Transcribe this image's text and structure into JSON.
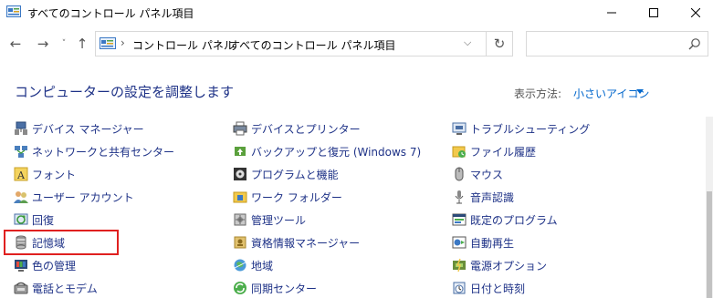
{
  "window": {
    "title": "すべてのコントロール パネル項目",
    "min_icon": "minimize-icon",
    "max_icon": "maximize-icon",
    "close_icon": "close-icon"
  },
  "nav": {
    "back": "←",
    "forward": "→",
    "recent": "˅",
    "up": "↑",
    "breadcrumb": [
      "コントロール パネル",
      "すべてのコントロール パネル項目"
    ],
    "separator": "›",
    "dropdown": "⌵",
    "refresh": "↻",
    "search_placeholder": ""
  },
  "heading": "コンピューターの設定を調整します",
  "view_by": {
    "label": "表示方法:",
    "value": "小さいアイコン"
  },
  "items": [
    {
      "label": "デバイス マネージャー",
      "icon": "device-manager-icon",
      "col": 0,
      "row": 0
    },
    {
      "label": "ネットワークと共有センター",
      "icon": "network-icon",
      "col": 0,
      "row": 1
    },
    {
      "label": "フォント",
      "icon": "fonts-icon",
      "col": 0,
      "row": 2
    },
    {
      "label": "ユーザー アカウント",
      "icon": "user-accounts-icon",
      "col": 0,
      "row": 3
    },
    {
      "label": "回復",
      "icon": "recovery-icon",
      "col": 0,
      "row": 4
    },
    {
      "label": "記憶域",
      "icon": "storage-icon",
      "col": 0,
      "row": 5
    },
    {
      "label": "色の管理",
      "icon": "color-management-icon",
      "col": 0,
      "row": 6
    },
    {
      "label": "電話とモデム",
      "icon": "phone-modem-icon",
      "col": 0,
      "row": 7
    },
    {
      "label": "デバイスとプリンター",
      "icon": "printer-icon",
      "col": 1,
      "row": 0
    },
    {
      "label": "バックアップと復元 (Windows 7)",
      "icon": "backup-icon",
      "col": 1,
      "row": 1
    },
    {
      "label": "プログラムと機能",
      "icon": "programs-icon",
      "col": 1,
      "row": 2
    },
    {
      "label": "ワーク フォルダー",
      "icon": "work-folders-icon",
      "col": 1,
      "row": 3
    },
    {
      "label": "管理ツール",
      "icon": "admin-tools-icon",
      "col": 1,
      "row": 4
    },
    {
      "label": "資格情報マネージャー",
      "icon": "credential-icon",
      "col": 1,
      "row": 5
    },
    {
      "label": "地域",
      "icon": "region-icon",
      "col": 1,
      "row": 6
    },
    {
      "label": "同期センター",
      "icon": "sync-icon",
      "col": 1,
      "row": 7
    },
    {
      "label": "トラブルシューティング",
      "icon": "troubleshoot-icon",
      "col": 2,
      "row": 0
    },
    {
      "label": "ファイル履歴",
      "icon": "file-history-icon",
      "col": 2,
      "row": 1
    },
    {
      "label": "マウス",
      "icon": "mouse-icon",
      "col": 2,
      "row": 2
    },
    {
      "label": "音声認識",
      "icon": "microphone-icon",
      "col": 2,
      "row": 3
    },
    {
      "label": "既定のプログラム",
      "icon": "default-programs-icon",
      "col": 2,
      "row": 4
    },
    {
      "label": "自動再生",
      "icon": "autoplay-icon",
      "col": 2,
      "row": 5
    },
    {
      "label": "電源オプション",
      "icon": "power-icon",
      "col": 2,
      "row": 6
    },
    {
      "label": "日付と時刻",
      "icon": "clock-icon",
      "col": 2,
      "row": 7
    }
  ],
  "highlighted_item": "記憶域",
  "colors": {
    "link": "#1e3287",
    "accent": "#0066cc",
    "highlight_border": "#e0201f"
  }
}
